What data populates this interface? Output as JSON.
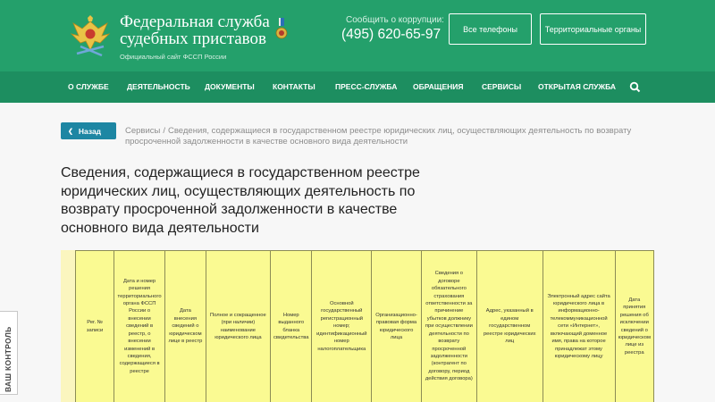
{
  "header": {
    "title_line1": "Федеральная служба",
    "title_line2": "судебных приставов",
    "subtitle": "Официальный сайт ФССП России",
    "corruption_label": "Сообщить о коррупции:",
    "corruption_phone": "(495) 620-65-97",
    "btn_phones": "Все телефоны",
    "btn_territorial": "Территориальные органы",
    "colors": {
      "bg": "#24a06b",
      "nav": "#1d8e60"
    }
  },
  "nav": {
    "items": [
      "О СЛУЖБЕ",
      "ДЕЯТЕЛЬНОСТЬ",
      "ДОКУМЕНТЫ",
      "КОНТАКТЫ",
      "ПРЕСС-СЛУЖБА",
      "ОБРАЩЕНИЯ",
      "СЕРВИСЫ",
      "ОТКРЫТАЯ СЛУЖБА"
    ],
    "search_icon": "search-icon"
  },
  "breadcrumb": {
    "back_label": "Назад",
    "root": "Сервисы",
    "separator": "/",
    "current": "Сведения, содержащиеся в государственном реестре юридических лиц, осуществляющих деятельность по возврату просроченной задолженности в качестве основного вида деятельности"
  },
  "page": {
    "title": "Сведения, содержащиеся в государственном реестре юридических лиц, осуществляющих деятельность по возврату просроченной задолженности в качестве основного вида деятельности"
  },
  "table": {
    "headers": [
      "Рег. № записи",
      "Дата и номер решения территориального органа ФССП России о внесении сведений в реестр, о внесении изменений в сведения, содержащиеся в реестре",
      "Дата внесения сведений о юридическом лице в реестр",
      "Полное и сокращенное (при наличии) наименование юридического лица",
      "Номер выданного бланка свидетельства",
      "Основной государственный регистрационный номер; идентификационный номер налогоплательщика",
      "Организационно-правовая форма юридического лица",
      "Сведения о договоре обязательного страхования ответственности за причинение убытков должнику при осуществлении деятельности по возврату просроченной задолженности (контрагент по договору, период действия договора)",
      "Адрес, указанный в едином государственном реестре юридических лиц",
      "Электронный адрес сайта юридического лица в информационно-телекоммуникационной сети «Интернет», включающий доменное имя, права на которое принадлежат этому юридическому лицу",
      "Дата принятия решения об исключении сведений о юридическом лице из реестра"
    ],
    "colors": {
      "cell": "#fafa92",
      "outer": "#fbf6bf"
    }
  },
  "side_tab": {
    "label": "ВАШ КОНТРОЛЬ"
  }
}
